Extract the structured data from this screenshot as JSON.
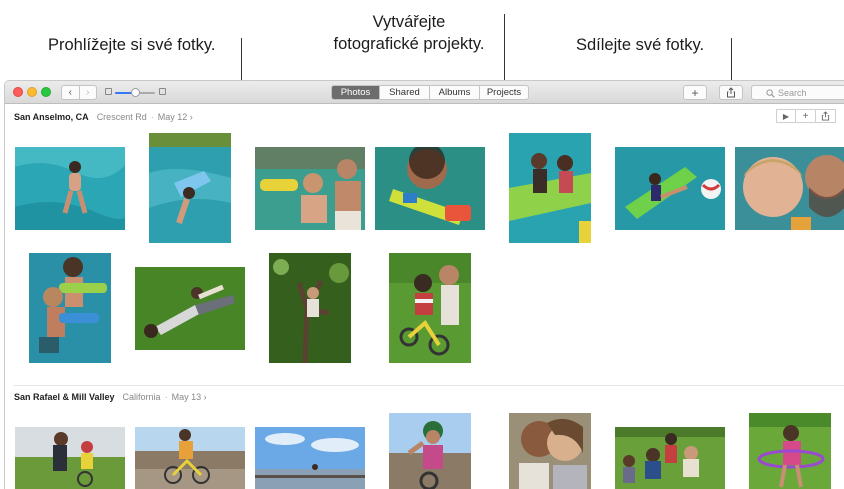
{
  "callouts": {
    "browse": "Prohlížejte si své fotky.",
    "projects_line1": "Vytvářejte",
    "projects_line2": "fotografické projekty.",
    "share": "Sdílejte své fotky."
  },
  "toolbar": {
    "back_glyph": "‹",
    "forward_glyph": "›",
    "zoom_level": 0.5,
    "tabs": [
      {
        "label": "Photos",
        "active": true
      },
      {
        "label": "Shared",
        "active": false
      },
      {
        "label": "Albums",
        "active": false
      },
      {
        "label": "Projects",
        "active": false
      }
    ],
    "add_glyph": "+",
    "search_placeholder": "Search"
  },
  "sections": [
    {
      "place": "San Anselmo, CA",
      "sublocation": "Crescent Rd",
      "separator": "·",
      "date": "May 12 ›",
      "tools": {
        "play": "▶",
        "add": "+",
        "share": "⇪"
      }
    },
    {
      "place": "San Rafael & Mill Valley",
      "sublocation": "California",
      "separator": "·",
      "date": "May 13 ›"
    }
  ],
  "colors": {
    "accent": "#3478f6",
    "pool_water": "#2aa6b4",
    "grass": "#4f8a2a",
    "sky": "#6aa8e6"
  }
}
